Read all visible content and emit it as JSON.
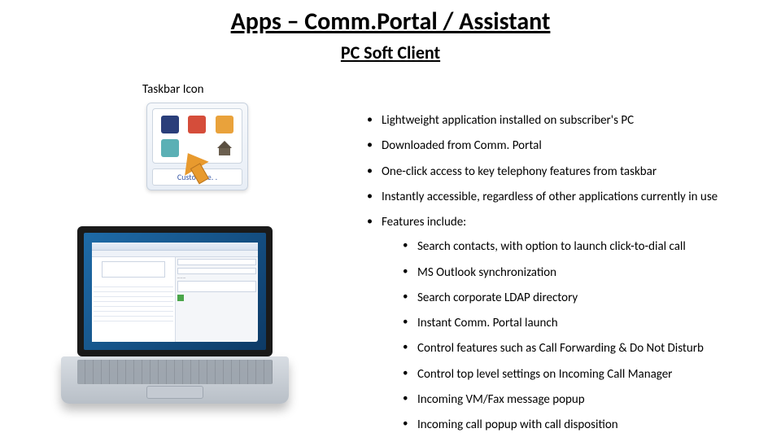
{
  "title": "Apps – Comm.Portal / Assistant",
  "subtitle": "PC Soft Client",
  "taskbar_label": "Taskbar Icon",
  "customize_label": "Customize. .",
  "bullets": {
    "b1": "Lightweight application installed on subscriber's PC",
    "b2": "Downloaded from Comm. Portal",
    "b3": "One-click access to key telephony features from taskbar",
    "b4": "Instantly accessible, regardless of other applications currently in use",
    "b5": "Features include:"
  },
  "sub_bullets": {
    "s1": "Search contacts, with option to launch click-to-dial call",
    "s2": "MS Outlook synchronization",
    "s3": "Search corporate LDAP directory",
    "s4": "Instant Comm. Portal launch",
    "s5": "Control features such as Call Forwarding & Do Not Disturb",
    "s6": "Control top level settings on Incoming Call Manager",
    "s7": "Incoming VM/Fax message popup",
    "s8": "Incoming call popup with call disposition"
  }
}
